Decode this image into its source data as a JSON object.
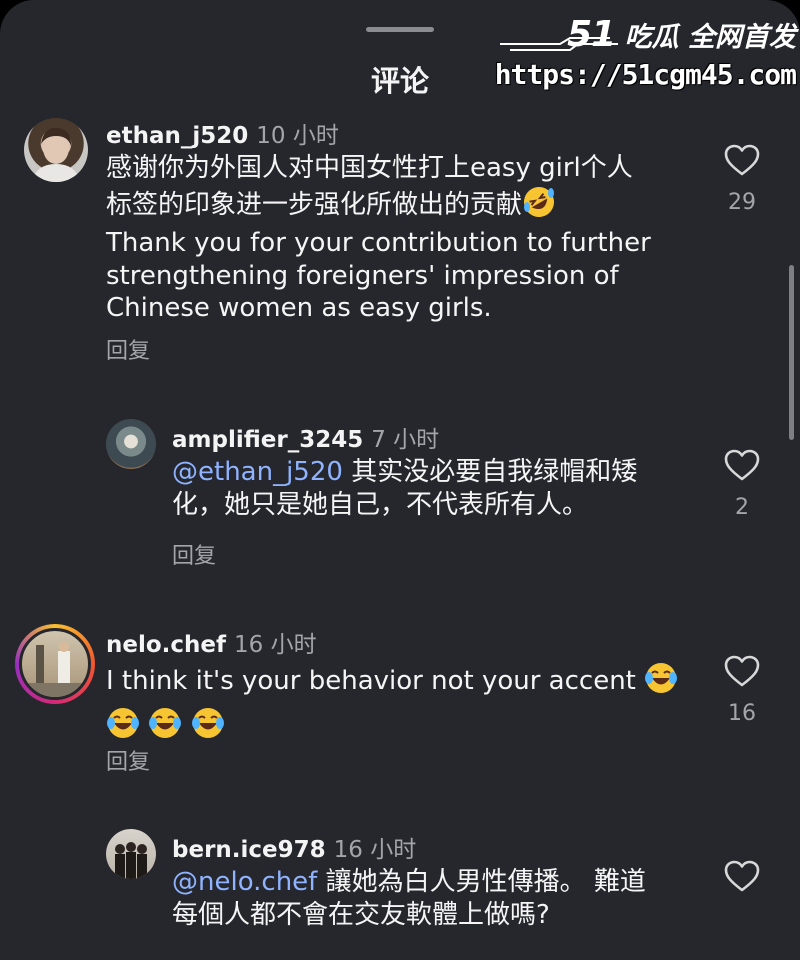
{
  "sheet": {
    "title": "评论"
  },
  "watermark": {
    "logo_number": "51",
    "logo_text": "吃瓜 全网首发",
    "url": "https://51cgm45.com"
  },
  "comments": [
    {
      "username": "ethan_j520",
      "time": "10 小时",
      "text_lines": [
        "感谢你为外国人对中国女性打上easy girl个人",
        "标签的印象进一步强化所做出的贡献",
        "Thank you for your contribution to further",
        "strengthening foreigners' impression of",
        "Chinese women as easy girls."
      ],
      "reply_label": "回复",
      "likes": "29"
    },
    {
      "username": "amplifier_3245",
      "time": "7 小时",
      "mention": "@ethan_j520",
      "text_line1": " 其实没必要自我绿帽和矮",
      "text_line2": "化，她只是她自己，不代表所有人。",
      "reply_label": "回复",
      "likes": "2"
    },
    {
      "username": "nelo.chef",
      "time": "16 小时",
      "text": "I think it's your behavior not your accent",
      "reply_label": "回复",
      "likes": "16"
    },
    {
      "username": "bern.ice978",
      "time": "16 小时",
      "mention": "@nelo.chef",
      "text_line1": " 讓她為白人男性傳播。 難道",
      "text_line2": "每個人都不會在交友軟體上做嗎?"
    }
  ],
  "icons": {
    "like": "heart-outline-icon",
    "emoji_rofl": "rolling-on-floor-laughing-emoji",
    "emoji_joy": "face-with-tears-of-joy-emoji"
  },
  "colors": {
    "background": "#25272d",
    "mention": "#8fb3ff",
    "muted": "#a3a5aa"
  }
}
